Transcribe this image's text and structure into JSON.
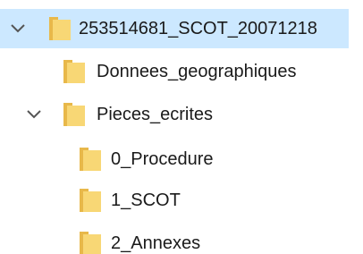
{
  "tree": {
    "root": {
      "label": "253514681_SCOT_20071218",
      "expanded": true,
      "selected": true
    },
    "children": [
      {
        "label": "Donnees_geographiques",
        "expanded": false
      },
      {
        "label": "Pieces_ecrites",
        "expanded": true,
        "children": [
          {
            "label": "0_Procedure"
          },
          {
            "label": "1_SCOT"
          },
          {
            "label": "2_Annexes"
          }
        ]
      }
    ]
  },
  "colors": {
    "selection": "#cce8ff",
    "folder_body": "#f8d775",
    "folder_tab": "#e8b84a",
    "chevron": "#555555"
  },
  "icons": {
    "expand": "chevron-down-icon",
    "folder": "folder-icon"
  }
}
